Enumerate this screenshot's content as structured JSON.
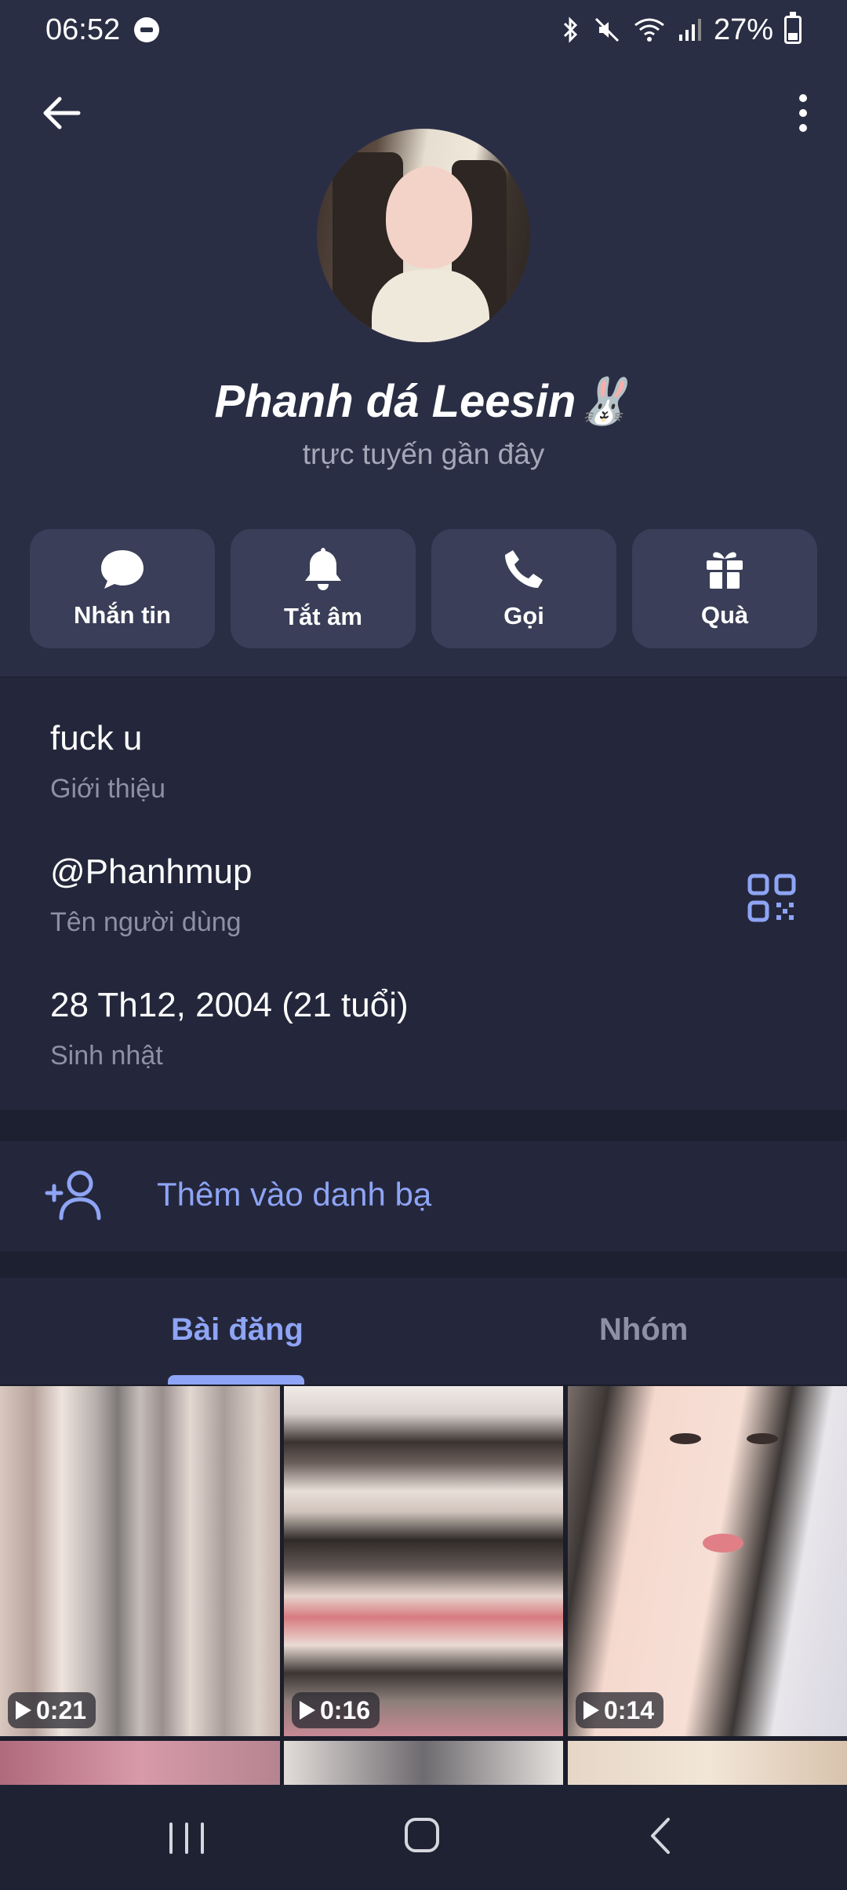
{
  "status_bar": {
    "time": "06:52",
    "battery": "27%"
  },
  "profile": {
    "name": "Phanh dá Leesin🐰",
    "status": "trực tuyến gần đây"
  },
  "actions": [
    {
      "label": "Nhắn tin",
      "icon": "message-icon"
    },
    {
      "label": "Tắt âm",
      "icon": "bell-icon"
    },
    {
      "label": "Gọi",
      "icon": "phone-icon"
    },
    {
      "label": "Quà",
      "icon": "gift-icon"
    }
  ],
  "info": {
    "bio": {
      "value": "fuck u",
      "label": "Giới thiệu"
    },
    "username": {
      "value": "@Phanhmup",
      "label": "Tên người dùng"
    },
    "birthday": {
      "value": "28 Th12, 2004 (21 tuổi)",
      "label": "Sinh nhật"
    }
  },
  "add_contact": {
    "label": "Thêm vào danh bạ"
  },
  "tabs": [
    {
      "label": "Bài đăng",
      "active": true
    },
    {
      "label": "Nhóm",
      "active": false
    }
  ],
  "media": [
    {
      "duration": "0:21"
    },
    {
      "duration": "0:16"
    },
    {
      "duration": "0:14"
    }
  ],
  "colors": {
    "background": "#2a2e44",
    "accent": "#8ea4f5",
    "button_bg": "#3a3e58"
  }
}
